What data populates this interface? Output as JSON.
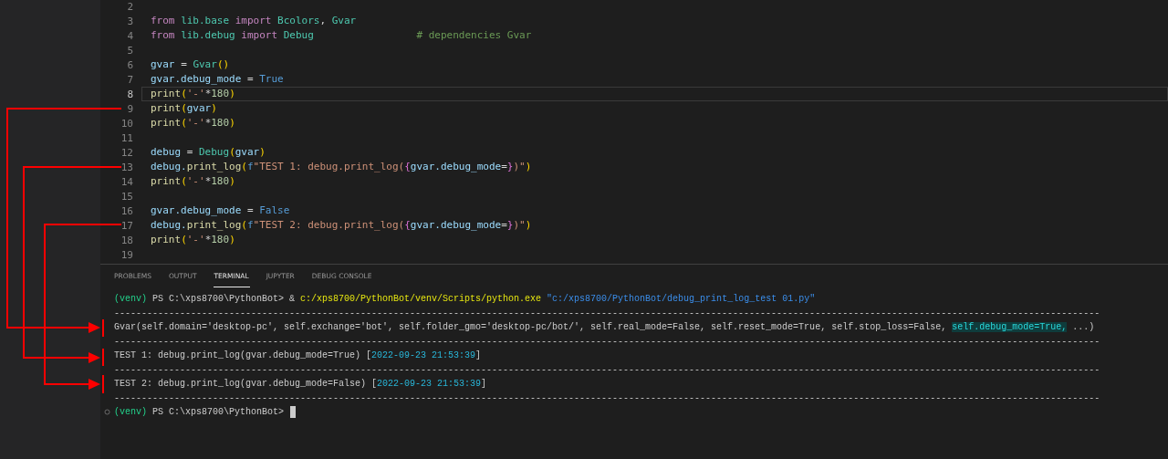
{
  "editor": {
    "lines": [
      {
        "number": "2",
        "current": false
      },
      {
        "number": "3",
        "current": false,
        "tokens": [
          {
            "text": "from ",
            "kind": "kw"
          },
          {
            "text": "lib.base ",
            "kind": "mod"
          },
          {
            "text": "import ",
            "kind": "kw"
          },
          {
            "text": "Bcolors",
            "kind": "cls"
          },
          {
            "text": ", ",
            "kind": "op"
          },
          {
            "text": "Gvar",
            "kind": "cls"
          }
        ]
      },
      {
        "number": "4",
        "current": false,
        "tokens": [
          {
            "text": "from ",
            "kind": "kw"
          },
          {
            "text": "lib.debug ",
            "kind": "mod"
          },
          {
            "text": "import ",
            "kind": "kw"
          },
          {
            "text": "Debug",
            "kind": "cls"
          },
          {
            "text": "                 # dependencies Gvar",
            "kind": "comment"
          }
        ]
      },
      {
        "number": "5",
        "current": false
      },
      {
        "number": "6",
        "current": false,
        "tokens": [
          {
            "text": "gvar ",
            "kind": "var"
          },
          {
            "text": "= ",
            "kind": "op"
          },
          {
            "text": "Gvar",
            "kind": "cls"
          },
          {
            "text": "()",
            "kind": "paren"
          }
        ]
      },
      {
        "number": "7",
        "current": false,
        "tokens": [
          {
            "text": "gvar.debug_mode ",
            "kind": "var"
          },
          {
            "text": "= ",
            "kind": "op"
          },
          {
            "text": "True",
            "kind": "const"
          }
        ]
      },
      {
        "number": "8",
        "current": true,
        "tokens": [
          {
            "text": "print",
            "kind": "fn"
          },
          {
            "text": "(",
            "kind": "paren"
          },
          {
            "text": "'-'",
            "kind": "str"
          },
          {
            "text": "*",
            "kind": "op"
          },
          {
            "text": "180",
            "kind": "num"
          },
          {
            "text": ")",
            "kind": "paren"
          }
        ]
      },
      {
        "number": "9",
        "current": false,
        "tokens": [
          {
            "text": "print",
            "kind": "fn"
          },
          {
            "text": "(",
            "kind": "paren"
          },
          {
            "text": "gvar",
            "kind": "var"
          },
          {
            "text": ")",
            "kind": "paren"
          }
        ]
      },
      {
        "number": "10",
        "current": false,
        "tokens": [
          {
            "text": "print",
            "kind": "fn"
          },
          {
            "text": "(",
            "kind": "paren"
          },
          {
            "text": "'-'",
            "kind": "str"
          },
          {
            "text": "*",
            "kind": "op"
          },
          {
            "text": "180",
            "kind": "num"
          },
          {
            "text": ")",
            "kind": "paren"
          }
        ]
      },
      {
        "number": "11",
        "current": false
      },
      {
        "number": "12",
        "current": false,
        "tokens": [
          {
            "text": "debug ",
            "kind": "var"
          },
          {
            "text": "= ",
            "kind": "op"
          },
          {
            "text": "Debug",
            "kind": "cls"
          },
          {
            "text": "(",
            "kind": "paren"
          },
          {
            "text": "gvar",
            "kind": "var"
          },
          {
            "text": ")",
            "kind": "paren"
          }
        ]
      },
      {
        "number": "13",
        "current": false,
        "tokens": [
          {
            "text": "debug.",
            "kind": "var"
          },
          {
            "text": "print_log",
            "kind": "fn"
          },
          {
            "text": "(",
            "kind": "paren"
          },
          {
            "text": "f",
            "kind": "const"
          },
          {
            "text": "\"TEST 1: debug.print_log(",
            "kind": "str"
          },
          {
            "text": "{",
            "kind": "brace"
          },
          {
            "text": "gvar.debug_mode",
            "kind": "var"
          },
          {
            "text": "=",
            "kind": "op"
          },
          {
            "text": "}",
            "kind": "brace"
          },
          {
            "text": ")\"",
            "kind": "str"
          },
          {
            "text": ")",
            "kind": "paren"
          }
        ]
      },
      {
        "number": "14",
        "current": false,
        "tokens": [
          {
            "text": "print",
            "kind": "fn"
          },
          {
            "text": "(",
            "kind": "paren"
          },
          {
            "text": "'-'",
            "kind": "str"
          },
          {
            "text": "*",
            "kind": "op"
          },
          {
            "text": "180",
            "kind": "num"
          },
          {
            "text": ")",
            "kind": "paren"
          }
        ]
      },
      {
        "number": "15",
        "current": false
      },
      {
        "number": "16",
        "current": false,
        "tokens": [
          {
            "text": "gvar.debug_mode ",
            "kind": "var"
          },
          {
            "text": "= ",
            "kind": "op"
          },
          {
            "text": "False",
            "kind": "const"
          }
        ]
      },
      {
        "number": "17",
        "current": false,
        "tokens": [
          {
            "text": "debug.",
            "kind": "var"
          },
          {
            "text": "print_log",
            "kind": "fn"
          },
          {
            "text": "(",
            "kind": "paren"
          },
          {
            "text": "f",
            "kind": "const"
          },
          {
            "text": "\"TEST 2: debug.print_log(",
            "kind": "str"
          },
          {
            "text": "{",
            "kind": "brace"
          },
          {
            "text": "gvar.debug_mode",
            "kind": "var"
          },
          {
            "text": "=",
            "kind": "op"
          },
          {
            "text": "}",
            "kind": "brace"
          },
          {
            "text": ")\"",
            "kind": "str"
          },
          {
            "text": ")",
            "kind": "paren"
          }
        ]
      },
      {
        "number": "18",
        "current": false,
        "tokens": [
          {
            "text": "print",
            "kind": "fn"
          },
          {
            "text": "(",
            "kind": "paren"
          },
          {
            "text": "'-'",
            "kind": "str"
          },
          {
            "text": "*",
            "kind": "op"
          },
          {
            "text": "180",
            "kind": "num"
          },
          {
            "text": ")",
            "kind": "paren"
          }
        ]
      },
      {
        "number": "19",
        "current": false
      }
    ]
  },
  "panel": {
    "tabs": [
      {
        "label": "PROBLEMS",
        "selected": false
      },
      {
        "label": "OUTPUT",
        "selected": false
      },
      {
        "label": "TERMINAL",
        "selected": true
      },
      {
        "label": "JUPYTER",
        "selected": false
      },
      {
        "label": "DEBUG CONSOLE",
        "selected": false
      }
    ],
    "terminal": {
      "lines": [
        {
          "decoration": false,
          "cursor": false,
          "tokens": [
            {
              "text": "(venv) ",
              "kind": "venv"
            },
            {
              "text": "PS C:\\xps8700\\PythonBot> & ",
              "kind": "plain"
            },
            {
              "text": "c:/xps8700/PythonBot/venv/Scripts/python.exe ",
              "kind": "exe"
            },
            {
              "text": "\"c:/xps8700/PythonBot/debug_print_log_test 01.py\"",
              "kind": "path"
            }
          ]
        },
        {
          "decoration": false,
          "cursor": false,
          "tokens": [
            {
              "text": "------------------------------------------------------------------------------------------------------------------------------------------------------------------------------------",
              "kind": "plain"
            }
          ]
        },
        {
          "decoration": false,
          "cursor": false,
          "tokens": [
            {
              "text": "Gvar(self.domain='desktop-pc', self.exchange='bot', self.folder_gmo='desktop-pc/bot/', self.real_mode=False, self.reset_mode=True, self.stop_loss=False, ",
              "kind": "plain"
            },
            {
              "text": "self.debug_mode=True,",
              "kind": "highlight"
            },
            {
              "text": " ...)",
              "kind": "plain"
            }
          ]
        },
        {
          "decoration": false,
          "cursor": false,
          "tokens": [
            {
              "text": "------------------------------------------------------------------------------------------------------------------------------------------------------------------------------------",
              "kind": "plain"
            }
          ]
        },
        {
          "decoration": false,
          "cursor": false,
          "tokens": [
            {
              "text": "TEST 1: debug.print_log(gvar.debug_mode=True) [",
              "kind": "plain"
            },
            {
              "text": "2022-09-23 21:53:39",
              "kind": "time"
            },
            {
              "text": "]",
              "kind": "plain"
            }
          ]
        },
        {
          "decoration": false,
          "cursor": false,
          "tokens": [
            {
              "text": "------------------------------------------------------------------------------------------------------------------------------------------------------------------------------------",
              "kind": "plain"
            }
          ]
        },
        {
          "decoration": false,
          "cursor": false,
          "tokens": [
            {
              "text": "TEST 2: debug.print_log(gvar.debug_mode=False) [",
              "kind": "plain"
            },
            {
              "text": "2022-09-23 21:53:39",
              "kind": "time"
            },
            {
              "text": "]",
              "kind": "plain"
            }
          ]
        },
        {
          "decoration": false,
          "cursor": false,
          "tokens": [
            {
              "text": "------------------------------------------------------------------------------------------------------------------------------------------------------------------------------------",
              "kind": "plain"
            }
          ]
        },
        {
          "decoration": true,
          "cursor": true,
          "tokens": [
            {
              "text": "(venv) ",
              "kind": "venv"
            },
            {
              "text": "PS C:\\xps8700\\PythonBot> ",
              "kind": "plain"
            }
          ]
        }
      ]
    }
  }
}
